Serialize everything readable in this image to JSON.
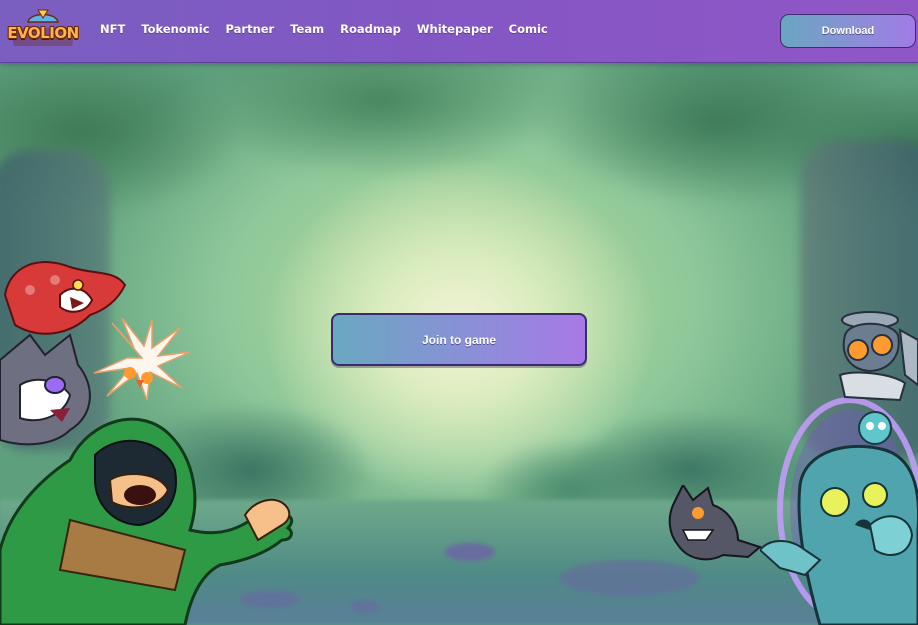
{
  "brand": {
    "logo_text": "EVOLION"
  },
  "nav": {
    "items": [
      {
        "label": "NFT"
      },
      {
        "label": "Tokenomic"
      },
      {
        "label": "Partner"
      },
      {
        "label": "Team"
      },
      {
        "label": "Roadmap"
      },
      {
        "label": "Whitepaper"
      },
      {
        "label": "Comic"
      }
    ]
  },
  "header": {
    "download_label": "Download"
  },
  "hero": {
    "join_label": "Join to game"
  },
  "colors": {
    "header_bg": "#8257c4",
    "button_gradient_start": "#6aa8c0",
    "button_gradient_end": "#a779e6",
    "logo_orange": "#ffb34a"
  },
  "decorations": {
    "characters_left": [
      "red-dragon-creature-icon",
      "grey-wolf-creature-icon",
      "white-flower-spirit-icon",
      "green-hooded-hero-icon"
    ],
    "characters_right": [
      "robot-bee-creature-icon",
      "grey-dragon-creature-icon",
      "teal-robot-monster-icon"
    ]
  }
}
